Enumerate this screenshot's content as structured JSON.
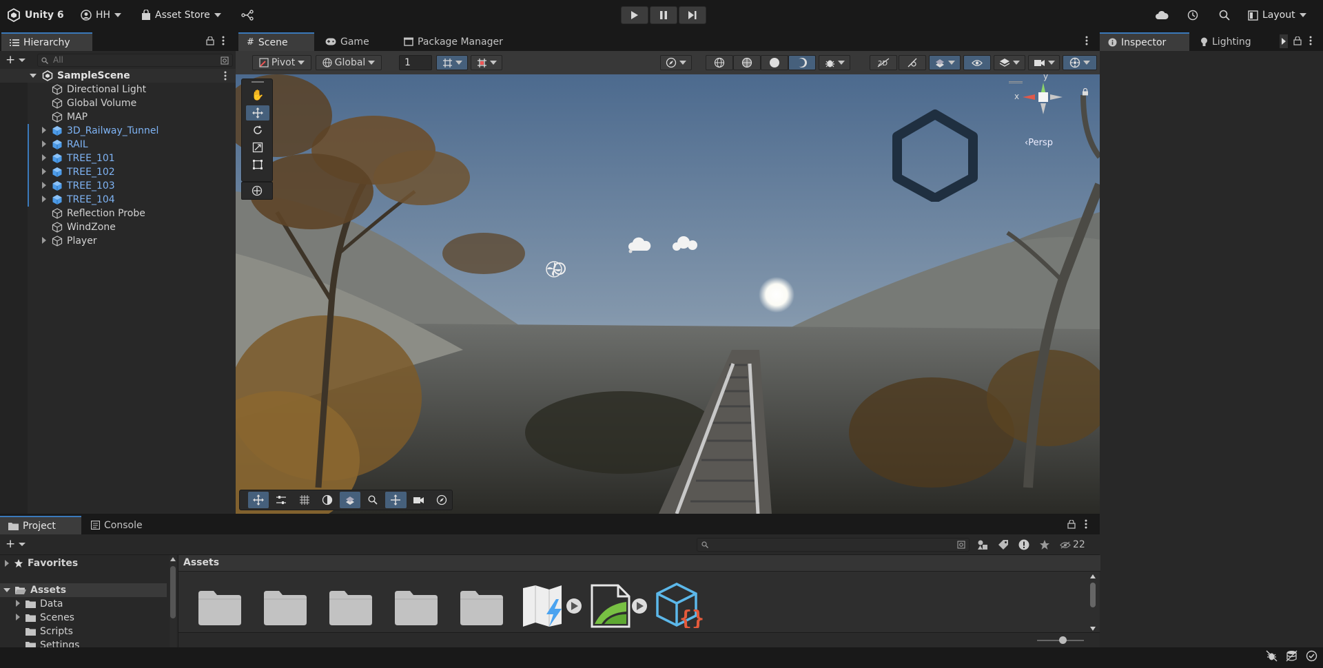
{
  "toolbar": {
    "app_name": "Unity 6",
    "account_label": "HH",
    "asset_store_label": "Asset Store",
    "layout_label": "Layout"
  },
  "hierarchy": {
    "tab_label": "Hierarchy",
    "search_placeholder": "All",
    "scene_name": "SampleScene",
    "items": [
      {
        "label": "Directional Light",
        "prefab": false,
        "expandable": false
      },
      {
        "label": "Global Volume",
        "prefab": false,
        "expandable": false
      },
      {
        "label": "MAP",
        "prefab": false,
        "expandable": false
      },
      {
        "label": "3D_Railway_Tunnel",
        "prefab": true,
        "expandable": true
      },
      {
        "label": "RAIL",
        "prefab": true,
        "expandable": true
      },
      {
        "label": "TREE_101",
        "prefab": true,
        "expandable": true
      },
      {
        "label": "TREE_102",
        "prefab": true,
        "expandable": true
      },
      {
        "label": "TREE_103",
        "prefab": true,
        "expandable": true
      },
      {
        "label": "TREE_104",
        "prefab": true,
        "expandable": true
      },
      {
        "label": "Reflection Probe",
        "prefab": false,
        "expandable": false
      },
      {
        "label": "WindZone",
        "prefab": false,
        "expandable": false
      },
      {
        "label": "Player",
        "prefab": false,
        "expandable": true
      }
    ]
  },
  "scene_tabs": {
    "scene": "Scene",
    "game": "Game",
    "package_manager": "Package Manager"
  },
  "scene_toolbar": {
    "pivot_label": "Pivot",
    "global_label": "Global",
    "grid_value": "1"
  },
  "gizmo": {
    "persp_label": "‹Persp",
    "x_label": "x",
    "y_label": "y"
  },
  "inspector": {
    "inspector_tab": "Inspector",
    "lighting_tab": "Lighting"
  },
  "project": {
    "project_tab": "Project",
    "console_tab": "Console",
    "hidden_count": "22",
    "favorites_label": "Favorites",
    "assets_label": "Assets",
    "assets_breadcrumb": "Assets",
    "tree_items": [
      "Data",
      "Scenes",
      "Scripts",
      "Settings"
    ],
    "zoom_fraction": 0.55
  },
  "colors": {
    "accent": "#3a79bb",
    "prefab_text": "#7fb4f5",
    "active_tool": "#46607c"
  }
}
